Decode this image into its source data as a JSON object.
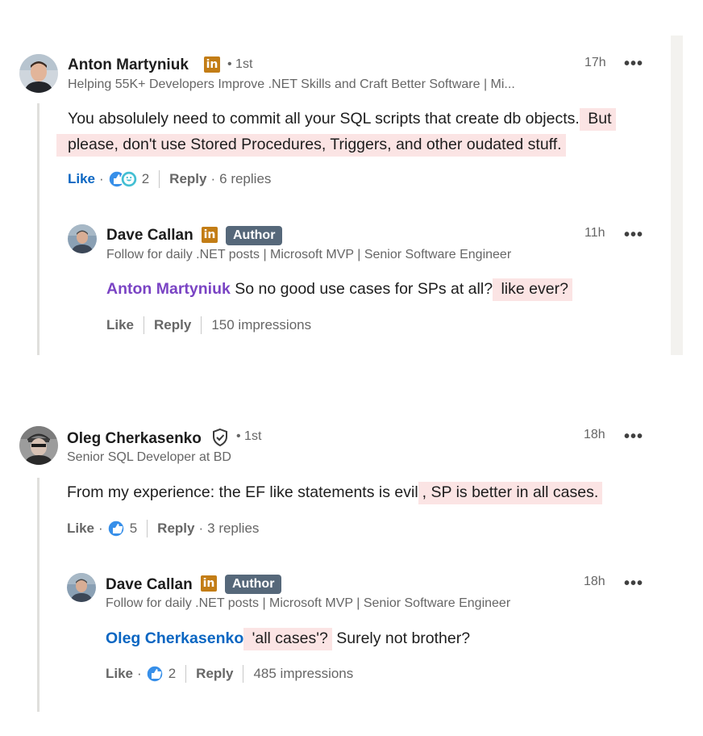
{
  "comments": [
    {
      "author": "Anton Martyniuk",
      "degree": "• 1st",
      "headline": "Helping 55K+ Developers Improve .NET Skills and Craft Better Software | Mi...",
      "time": "17h",
      "more": "•••",
      "text_part1": "You absolulely need to commit all your SQL scripts that create db objects.",
      "text_highlight1": " But",
      "text_highlight2": "please, don't use Stored Procedures, Triggers, and other oudated stuff.",
      "like_label": "Like",
      "reaction_count": "2",
      "reply_label": "Reply",
      "replies_count": "6 replies",
      "reply": {
        "author": "Dave Callan",
        "badge": "Author",
        "headline": "Follow for daily .NET posts | Microsoft MVP | Senior Software Engineer",
        "time": "11h",
        "more": "•••",
        "mention": "Anton Martyniuk",
        "text": " So no good use cases for SPs at all?",
        "highlight": " like ever?",
        "like_label": "Like",
        "reply_label": "Reply",
        "impressions": "150 impressions"
      }
    },
    {
      "author": "Oleg Cherkasenko",
      "degree": "• 1st",
      "headline": "Senior SQL Developer at BD",
      "time": "18h",
      "more": "•••",
      "text_part1": "From my experience: the EF like statements is evil",
      "text_highlight1": ", SP is better in all cases.",
      "like_label": "Like",
      "reaction_count": "5",
      "reply_label": "Reply",
      "replies_count": "3 replies",
      "reply": {
        "author": "Dave Callan",
        "badge": "Author",
        "headline": "Follow for daily .NET posts | Microsoft MVP | Senior Software Engineer",
        "time": "18h",
        "more": "•••",
        "mention": "Oleg Cherkasenko",
        "highlight": " 'all cases'?",
        "text": " Surely not brother?",
        "like_label": "Like",
        "reaction_count": "2",
        "reply_label": "Reply",
        "impressions": "485 impressions"
      }
    }
  ],
  "icons": {
    "linkedin": "in-badge",
    "verified": "shield-check-icon",
    "more": "more-options-icon",
    "like": "like-reaction-icon",
    "funny": "funny-reaction-icon"
  },
  "colors": {
    "highlight": "#fbe4e4",
    "author_badge": "#56687a",
    "linkedin_badge": "#c37d16",
    "mention_purple": "#7a44c4",
    "link_blue": "#0a66c2"
  }
}
